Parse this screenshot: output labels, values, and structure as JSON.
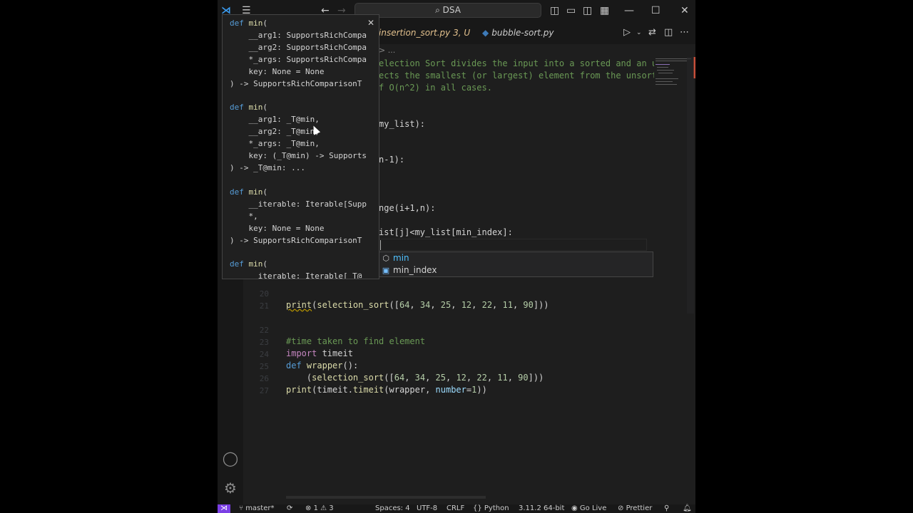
{
  "titlebar": {
    "search_label": "DSA",
    "layout_icons": [
      "sidebar-left-icon",
      "panel-icon",
      "sidebar-right-icon",
      "customize-layout-icon"
    ],
    "window_controls": [
      "minimize",
      "maximize",
      "close"
    ]
  },
  "tabs": [
    {
      "label": "insertion_sort.py 3, U",
      "active": false
    },
    {
      "label": "bubble-sort.py",
      "active": false
    }
  ],
  "breadcrumb": "> ...",
  "editor": {
    "visible_lines": [
      "election Sort divides the input into a sorted and an un",
      "ects the smallest (or largest) element from the unsorte",
      "f O(n^2) in all cases.",
      "my_list):",
      "n-1):",
      "nge(i+1,n):",
      "ist[j]<my_list[min_index]:"
    ],
    "lines": [
      {
        "no": "20",
        "text": ""
      },
      {
        "no": "21",
        "text": "print(selection_sort([64, 34, 25, 12, 22, 11, 90]))"
      },
      {
        "no": "22",
        "text": ""
      },
      {
        "no": "23",
        "text": "#time taken to find element"
      },
      {
        "no": "24",
        "text": "import timeit"
      },
      {
        "no": "25",
        "text": "def wrapper():"
      },
      {
        "no": "26",
        "text": "    (selection_sort([64, 34, 25, 12, 22, 11, 90]))"
      },
      {
        "no": "27",
        "text": "print(timeit.timeit(wrapper, number=1))"
      }
    ]
  },
  "hover": {
    "overloads": [
      [
        "def min(",
        "    __arg1: SupportsRichCompa",
        "    __arg2: SupportsRichCompa",
        "    *_args: SupportsRichCompa",
        "    key: None = None",
        ") -> SupportsRichComparisonT"
      ],
      [
        "def min(",
        "    __arg1: _T@min,",
        "    __arg2: _T@min,",
        "    *_args: _T@min,",
        "    key: (_T@min) -> Supports",
        ") -> _T@min: ..."
      ],
      [
        "def min(",
        "    __iterable: Iterable[Supp",
        "    *,",
        "    key: None = None",
        ") -> SupportsRichComparisonT"
      ],
      [
        "def min(",
        "    __iterable: Iterable[_T@"
      ]
    ]
  },
  "suggest": {
    "items": [
      {
        "label": "min",
        "icon": "symbol-method-icon"
      },
      {
        "label": "min_index",
        "icon": "symbol-variable-icon"
      }
    ]
  },
  "statusbar": {
    "branch": "master*",
    "sync": "",
    "problems": "1",
    "warnings": "3",
    "spaces": "Spaces: 4",
    "encoding": "UTF-8",
    "eol": "CRLF",
    "language": "Python",
    "interpreter": "3.11.2 64-bit",
    "go_live": "Go Live",
    "prettier": "Prettier"
  },
  "colors": {
    "remote_indicator": "#7b3fe4",
    "editor_bg": "#1e1e1e"
  }
}
